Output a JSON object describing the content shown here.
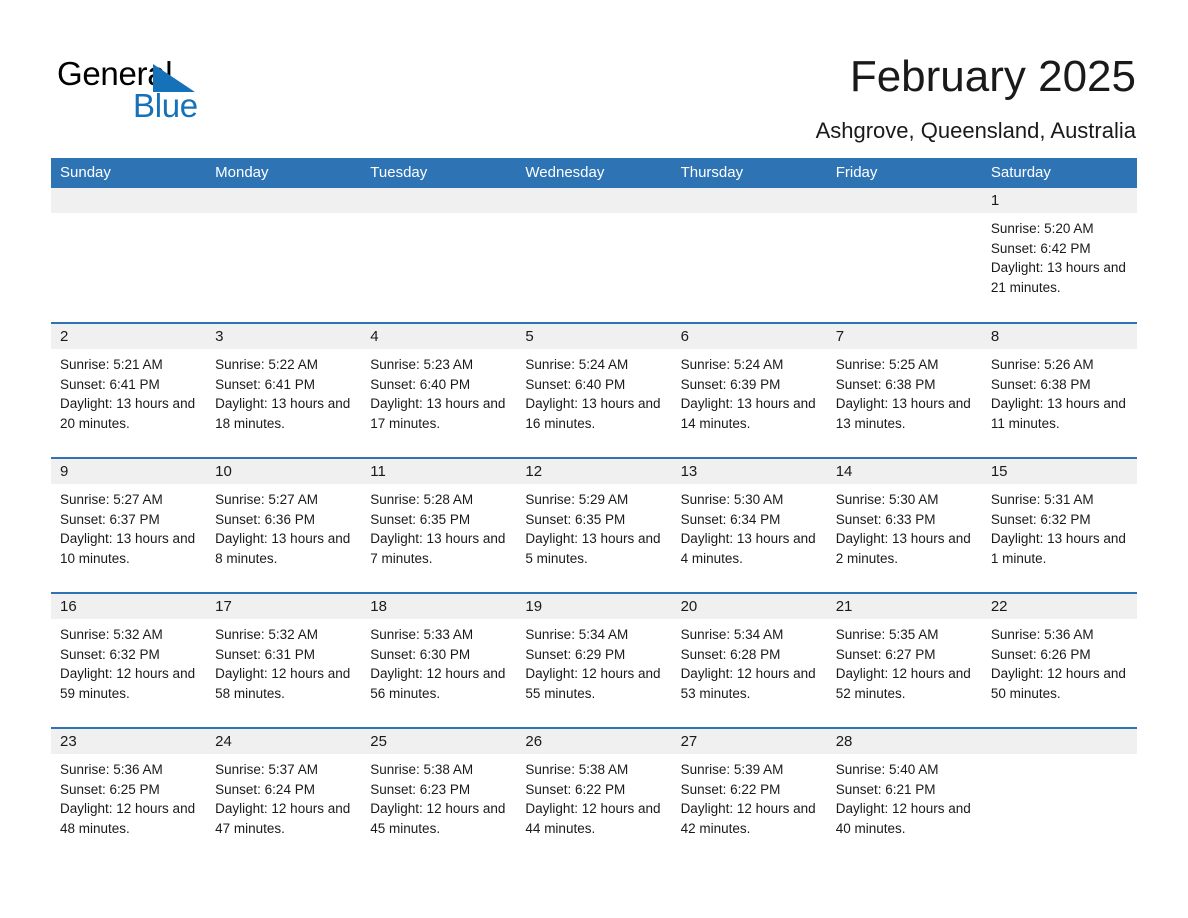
{
  "brand": {
    "name_part1": "General",
    "name_part2": "Blue"
  },
  "header": {
    "title": "February 2025",
    "subtitle": "Ashgrove, Queensland, Australia"
  },
  "weekday_headers": [
    "Sunday",
    "Monday",
    "Tuesday",
    "Wednesday",
    "Thursday",
    "Friday",
    "Saturday"
  ],
  "colors": {
    "header_blue": "#2e74b5",
    "logo_blue": "#1672b8",
    "daynum_band": "#f0f0f0",
    "text": "#1a1a1a"
  },
  "labels": {
    "sunrise_prefix": "Sunrise: ",
    "sunset_prefix": "Sunset: ",
    "daylight_prefix": "Daylight: "
  },
  "weeks": [
    [
      {
        "blank": true,
        "day": ""
      },
      {
        "blank": true,
        "day": ""
      },
      {
        "blank": true,
        "day": ""
      },
      {
        "blank": true,
        "day": ""
      },
      {
        "blank": true,
        "day": ""
      },
      {
        "blank": true,
        "day": ""
      },
      {
        "blank": false,
        "day": "1",
        "sunrise": "Sunrise: 5:20 AM",
        "sunset": "Sunset: 6:42 PM",
        "daylight": "Daylight: 13 hours and 21 minutes."
      }
    ],
    [
      {
        "blank": false,
        "day": "2",
        "sunrise": "Sunrise: 5:21 AM",
        "sunset": "Sunset: 6:41 PM",
        "daylight": "Daylight: 13 hours and 20 minutes."
      },
      {
        "blank": false,
        "day": "3",
        "sunrise": "Sunrise: 5:22 AM",
        "sunset": "Sunset: 6:41 PM",
        "daylight": "Daylight: 13 hours and 18 minutes."
      },
      {
        "blank": false,
        "day": "4",
        "sunrise": "Sunrise: 5:23 AM",
        "sunset": "Sunset: 6:40 PM",
        "daylight": "Daylight: 13 hours and 17 minutes."
      },
      {
        "blank": false,
        "day": "5",
        "sunrise": "Sunrise: 5:24 AM",
        "sunset": "Sunset: 6:40 PM",
        "daylight": "Daylight: 13 hours and 16 minutes."
      },
      {
        "blank": false,
        "day": "6",
        "sunrise": "Sunrise: 5:24 AM",
        "sunset": "Sunset: 6:39 PM",
        "daylight": "Daylight: 13 hours and 14 minutes."
      },
      {
        "blank": false,
        "day": "7",
        "sunrise": "Sunrise: 5:25 AM",
        "sunset": "Sunset: 6:38 PM",
        "daylight": "Daylight: 13 hours and 13 minutes."
      },
      {
        "blank": false,
        "day": "8",
        "sunrise": "Sunrise: 5:26 AM",
        "sunset": "Sunset: 6:38 PM",
        "daylight": "Daylight: 13 hours and 11 minutes."
      }
    ],
    [
      {
        "blank": false,
        "day": "9",
        "sunrise": "Sunrise: 5:27 AM",
        "sunset": "Sunset: 6:37 PM",
        "daylight": "Daylight: 13 hours and 10 minutes."
      },
      {
        "blank": false,
        "day": "10",
        "sunrise": "Sunrise: 5:27 AM",
        "sunset": "Sunset: 6:36 PM",
        "daylight": "Daylight: 13 hours and 8 minutes."
      },
      {
        "blank": false,
        "day": "11",
        "sunrise": "Sunrise: 5:28 AM",
        "sunset": "Sunset: 6:35 PM",
        "daylight": "Daylight: 13 hours and 7 minutes."
      },
      {
        "blank": false,
        "day": "12",
        "sunrise": "Sunrise: 5:29 AM",
        "sunset": "Sunset: 6:35 PM",
        "daylight": "Daylight: 13 hours and 5 minutes."
      },
      {
        "blank": false,
        "day": "13",
        "sunrise": "Sunrise: 5:30 AM",
        "sunset": "Sunset: 6:34 PM",
        "daylight": "Daylight: 13 hours and 4 minutes."
      },
      {
        "blank": false,
        "day": "14",
        "sunrise": "Sunrise: 5:30 AM",
        "sunset": "Sunset: 6:33 PM",
        "daylight": "Daylight: 13 hours and 2 minutes."
      },
      {
        "blank": false,
        "day": "15",
        "sunrise": "Sunrise: 5:31 AM",
        "sunset": "Sunset: 6:32 PM",
        "daylight": "Daylight: 13 hours and 1 minute."
      }
    ],
    [
      {
        "blank": false,
        "day": "16",
        "sunrise": "Sunrise: 5:32 AM",
        "sunset": "Sunset: 6:32 PM",
        "daylight": "Daylight: 12 hours and 59 minutes."
      },
      {
        "blank": false,
        "day": "17",
        "sunrise": "Sunrise: 5:32 AM",
        "sunset": "Sunset: 6:31 PM",
        "daylight": "Daylight: 12 hours and 58 minutes."
      },
      {
        "blank": false,
        "day": "18",
        "sunrise": "Sunrise: 5:33 AM",
        "sunset": "Sunset: 6:30 PM",
        "daylight": "Daylight: 12 hours and 56 minutes."
      },
      {
        "blank": false,
        "day": "19",
        "sunrise": "Sunrise: 5:34 AM",
        "sunset": "Sunset: 6:29 PM",
        "daylight": "Daylight: 12 hours and 55 minutes."
      },
      {
        "blank": false,
        "day": "20",
        "sunrise": "Sunrise: 5:34 AM",
        "sunset": "Sunset: 6:28 PM",
        "daylight": "Daylight: 12 hours and 53 minutes."
      },
      {
        "blank": false,
        "day": "21",
        "sunrise": "Sunrise: 5:35 AM",
        "sunset": "Sunset: 6:27 PM",
        "daylight": "Daylight: 12 hours and 52 minutes."
      },
      {
        "blank": false,
        "day": "22",
        "sunrise": "Sunrise: 5:36 AM",
        "sunset": "Sunset: 6:26 PM",
        "daylight": "Daylight: 12 hours and 50 minutes."
      }
    ],
    [
      {
        "blank": false,
        "day": "23",
        "sunrise": "Sunrise: 5:36 AM",
        "sunset": "Sunset: 6:25 PM",
        "daylight": "Daylight: 12 hours and 48 minutes."
      },
      {
        "blank": false,
        "day": "24",
        "sunrise": "Sunrise: 5:37 AM",
        "sunset": "Sunset: 6:24 PM",
        "daylight": "Daylight: 12 hours and 47 minutes."
      },
      {
        "blank": false,
        "day": "25",
        "sunrise": "Sunrise: 5:38 AM",
        "sunset": "Sunset: 6:23 PM",
        "daylight": "Daylight: 12 hours and 45 minutes."
      },
      {
        "blank": false,
        "day": "26",
        "sunrise": "Sunrise: 5:38 AM",
        "sunset": "Sunset: 6:22 PM",
        "daylight": "Daylight: 12 hours and 44 minutes."
      },
      {
        "blank": false,
        "day": "27",
        "sunrise": "Sunrise: 5:39 AM",
        "sunset": "Sunset: 6:22 PM",
        "daylight": "Daylight: 12 hours and 42 minutes."
      },
      {
        "blank": false,
        "day": "28",
        "sunrise": "Sunrise: 5:40 AM",
        "sunset": "Sunset: 6:21 PM",
        "daylight": "Daylight: 12 hours and 40 minutes."
      },
      {
        "blank": true,
        "day": ""
      }
    ]
  ]
}
